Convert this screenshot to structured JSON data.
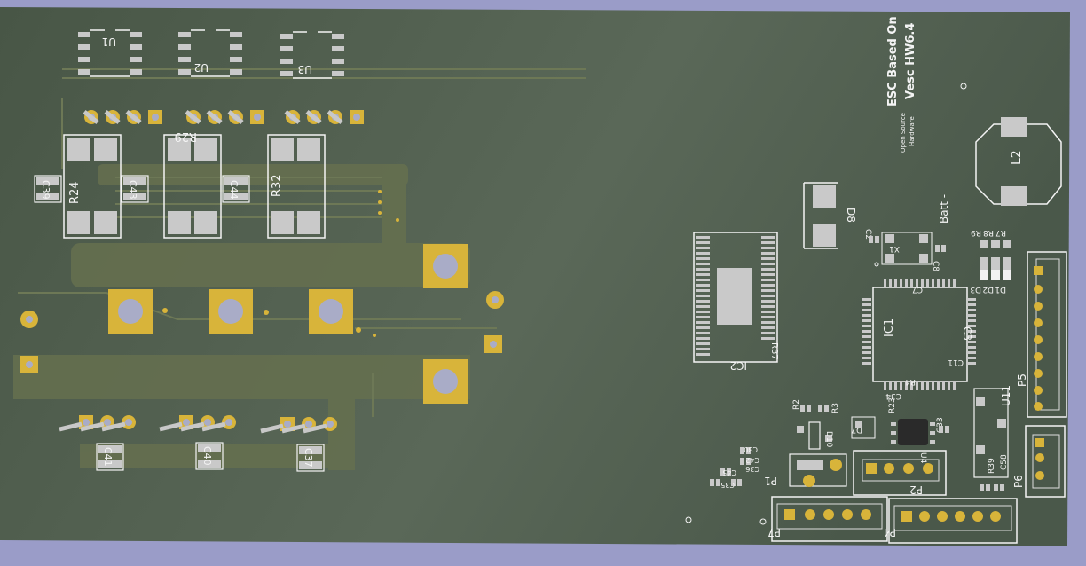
{
  "colors": {
    "background": "#9a9cc8",
    "board": "#4d5b4b",
    "copper_trace": "#6f7a58",
    "silkscreen": "#f4f4f4",
    "pad_gold": "#d8b43a",
    "smd_pad": "#c9c9c9"
  },
  "board_text": {
    "title_line1": "ESC Based On",
    "title_line2": "Vesc HW6.4",
    "oshw_line1": "Open Source",
    "oshw_line2": "Hardware",
    "batt_minus": "Batt -"
  },
  "references": {
    "U1": "U1",
    "U2": "U2",
    "U3": "U3",
    "R24": "R24",
    "R29": "R29",
    "R32": "R32",
    "C39": "C39",
    "C43": "C43",
    "C44": "C44",
    "C41": "C41",
    "C40": "C40",
    "C37": "C37",
    "IC1": "IC1",
    "IC2": "IC2",
    "R37": "R37",
    "D8": "D8",
    "L2": "L2",
    "C2": "C2",
    "X1": "X1",
    "C8": "C8",
    "C7": "C7",
    "C3": "C3",
    "C11": "C11",
    "C34": "C34",
    "R4": "R4",
    "R9": "R9",
    "R8": "R8",
    "R7": "R7",
    "D3": "D3",
    "D2": "D2",
    "D1": "D1",
    "P5": "P5",
    "U11": "U11",
    "P6": "P6",
    "R39": "R39",
    "C58": "C58",
    "R2": "R2",
    "R3": "R3",
    "R23": "R23",
    "D7": "D7",
    "D10": "D10",
    "U4": "U4",
    "C33": "C33",
    "P1": "P1",
    "P2": "P2",
    "P7": "P7",
    "P4": "P4",
    "C30": "C30",
    "C42": "C42",
    "C36": "C36",
    "C45": "C45",
    "C35": "C35"
  }
}
